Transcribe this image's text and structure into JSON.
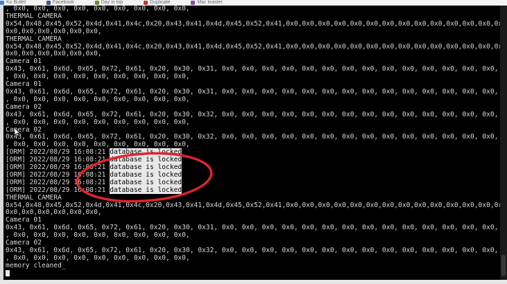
{
  "browser": {
    "bookmarks": [
      {
        "label": "Ko Bullet",
        "color": "#4a7bd0"
      },
      {
        "label": "Facebook",
        "color": "#3b5998"
      },
      {
        "label": "Day in top",
        "color": "#6b8e23"
      },
      {
        "label": "Duplicate",
        "color": "#c0392b"
      },
      {
        "label": "Mac toaster",
        "color": "#8e44ad"
      }
    ]
  },
  "terminal": {
    "lines": [
      ", 0x0, 0x0, 0x0, 0x0, 0x0, 0x0, 0x0, 0x0, 0x0,",
      "THERMAL CAMERA",
      "0x54,0x48,0x45,0x52,0x4d,0x41,0x4c,0x20,0x43,0x41,0x4d,0x45,0x52,0x41,0x0,0x0,0x0,0x0,0x0,0x0,0x0,0x0,0x0,0x0,0x0,0x0,0x0,0x0,",
      "0x0,0x0,0x0,0x0,0x0,0x0,",
      "THERMAL CAMERA",
      "0x54,0x48,0x45,0x52,0x4d,0x41,0x4c,0x20,0x43,0x41,0x4d,0x45,0x52,0x41,0x0,0x0,0x0,0x0,0x0,0x0,0x0,0x0,0x0,0x0,0x0,0x0,0x0,0x0,",
      "0x0,0x0,0x0,0x0,0x0,0x0,",
      "Camera 01",
      "0x43, 0x61, 0x6d, 0x65, 0x72, 0x61, 0x20, 0x30, 0x31, 0x0, 0x0, 0x0, 0x0, 0x0, 0x0, 0x0, 0x0, 0x0, 0x0, 0x0, 0x0, 0x0, 0x0, 0x0",
      ", 0x0, 0x0, 0x0, 0x0, 0x0, 0x0, 0x0, 0x0, 0x0,",
      "Camera 01",
      "0x43, 0x61, 0x6d, 0x65, 0x72, 0x61, 0x20, 0x30, 0x31, 0x0, 0x0, 0x0, 0x0, 0x0, 0x0, 0x0, 0x0, 0x0, 0x0, 0x0, 0x0, 0x0, 0x0, 0x0",
      ", 0x0, 0x0, 0x0, 0x0, 0x0, 0x0, 0x0, 0x0, 0x0,",
      "Camera 02",
      "0x43, 0x61, 0x6d, 0x65, 0x72, 0x61, 0x20, 0x30, 0x32, 0x0, 0x0, 0x0, 0x0, 0x0, 0x0, 0x0, 0x0, 0x0, 0x0, 0x0, 0x0, 0x0, 0x0, 0x0",
      ", 0x0, 0x0, 0x0, 0x0, 0x0, 0x0, 0x0, 0x0, 0x0,",
      "Camera 02",
      "0x43, 0x61, 0x6d, 0x65, 0x72, 0x61, 0x20, 0x30, 0x32, 0x0, 0x0, 0x0, 0x0, 0x0, 0x0, 0x0, 0x0, 0x0, 0x0, 0x0, 0x0, 0x0, 0x0, 0x0",
      ", 0x0, 0x0, 0x0, 0x0, 0x0, 0x0, 0x0, 0x0, 0x0,",
      "[ORM] 2022/08/29 16:08:21 database is locked",
      "[ORM] 2022/08/29 16:08:21 database is locked",
      "[ORM] 2022/08/29 16:08:21 database is locked",
      "[ORM] 2022/08/29 16:08:21 database is locked",
      "[ORM] 2022/08/29 16:08:21 database is locked",
      "[ORM] 2022/08/29 16:08:21 database is locked",
      "THERMAL CAMERA",
      "0x54,0x48,0x45,0x52,0x4d,0x41,0x4c,0x20,0x43,0x41,0x4d,0x45,0x52,0x41,0x0,0x0,0x0,0x0,0x0,0x0,0x0,0x0,0x0,0x0,0x0,0x0,0x0,0x0,",
      "0x0,0x0,0x0,0x0,0x0,0x0,",
      "Camera 01",
      "0x43, 0x61, 0x6d, 0x65, 0x72, 0x61, 0x20, 0x30, 0x31, 0x0, 0x0, 0x0, 0x0, 0x0, 0x0, 0x0, 0x0, 0x0, 0x0, 0x0, 0x0, 0x0, 0x0, 0x0",
      ", 0x0, 0x0, 0x0, 0x0, 0x0, 0x0, 0x0, 0x0, 0x0,",
      "Camera 02",
      "0x43, 0x61, 0x6d, 0x65, 0x72, 0x61, 0x20, 0x30, 0x32, 0x0, 0x0, 0x0, 0x0, 0x0, 0x0, 0x0, 0x0, 0x0, 0x0, 0x0, 0x0, 0x0, 0x0, 0x0",
      ", 0x0, 0x0, 0x0, 0x0, 0x0, 0x0, 0x0, 0x0, 0x0,",
      "memory cleaned"
    ],
    "highlighted_text": "database is locked",
    "prompt_cursor": "_"
  },
  "colors": {
    "terminal_bg": "#000000",
    "terminal_fg": "#d8d8d8",
    "annotation": "#e0242a"
  }
}
